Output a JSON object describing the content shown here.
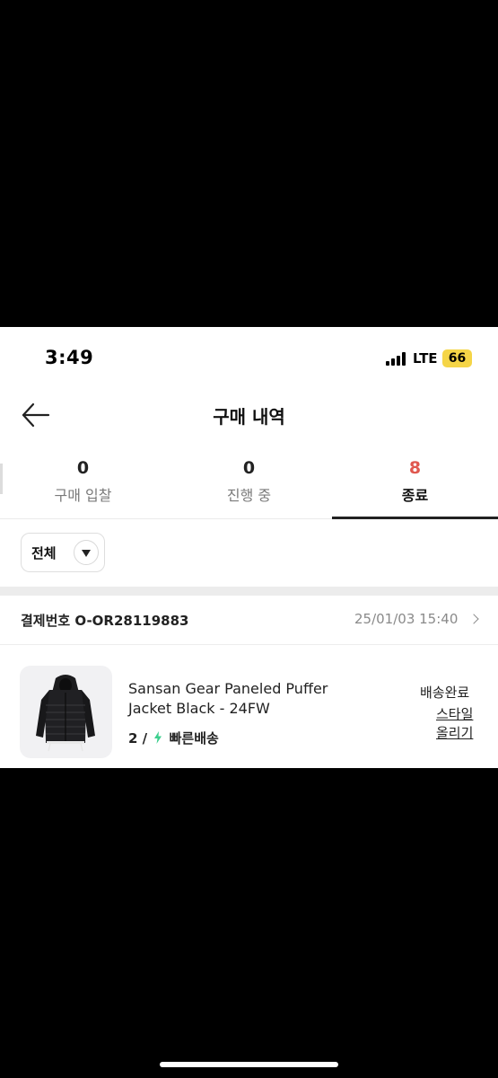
{
  "status_bar": {
    "time": "3:49",
    "network": "LTE",
    "battery": "66"
  },
  "header": {
    "title": "구매 내역",
    "back_icon": "arrow-left-icon"
  },
  "tabs": [
    {
      "count": "0",
      "label": "구매 입찰",
      "active": false
    },
    {
      "count": "0",
      "label": "진행 중",
      "active": false
    },
    {
      "count": "8",
      "label": "종료",
      "active": true
    }
  ],
  "colors": {
    "active_count": "#e0584f",
    "battery": "#f5d547",
    "fast_delivery_bolt": "#3ccf8e"
  },
  "filter": {
    "selected": "전체",
    "icon": "caret-down-icon"
  },
  "order": {
    "number_label": "결제번호 O-OR28119883",
    "datetime": "25/01/03 15:40"
  },
  "product": {
    "name_line1": "Sansan Gear Paneled Puffer",
    "name_line2": "Jacket Black - 24FW",
    "size": "2 /",
    "delivery": "빠른배송",
    "delivery_icon": "lightning-icon",
    "status": "배송완료",
    "style_link_line1": "스타일",
    "style_link_line2": "올리기"
  }
}
